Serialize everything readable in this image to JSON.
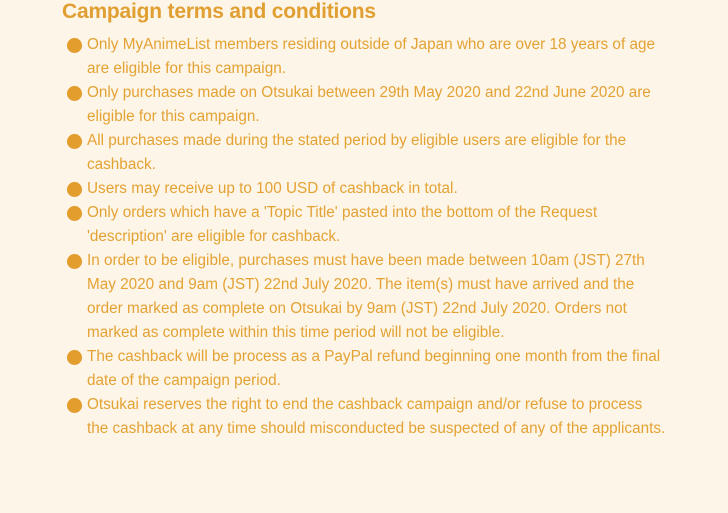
{
  "section": {
    "title": "Campaign terms and conditions",
    "bullet_icon": "filled-circle",
    "accent_color": "#e29d2c",
    "background_color": "#fdf5e8"
  },
  "terms": [
    "Only MyAnimeList members residing outside of Japan who are over 18 years of age are eligible for this campaign.",
    "Only purchases made on Otsukai between 29th May 2020 and 22nd June 2020 are eligible for this campaign.",
    "All purchases made during the stated period by eligible users are eligible for the cashback.",
    "Users may receive up to 100 USD of cashback in total.",
    "Only orders which have a 'Topic Title' pasted into the bottom of the Request 'description' are eligible for cashback.",
    "In order to be eligible, purchases must have been made between 10am (JST) 27th May 2020 and 9am (JST) 22nd July 2020. The item(s) must have arrived and the order marked as complete on Otsukai by 9am (JST) 22nd July 2020. Orders not marked as complete within this time period will not be eligible.",
    "The cashback will be process as a PayPal refund beginning one month from the final date of the campaign period.",
    "Otsukai reserves the right to end the cashback campaign and/or refuse to process the cashback at any time should misconducted be suspected of any of the applicants."
  ]
}
